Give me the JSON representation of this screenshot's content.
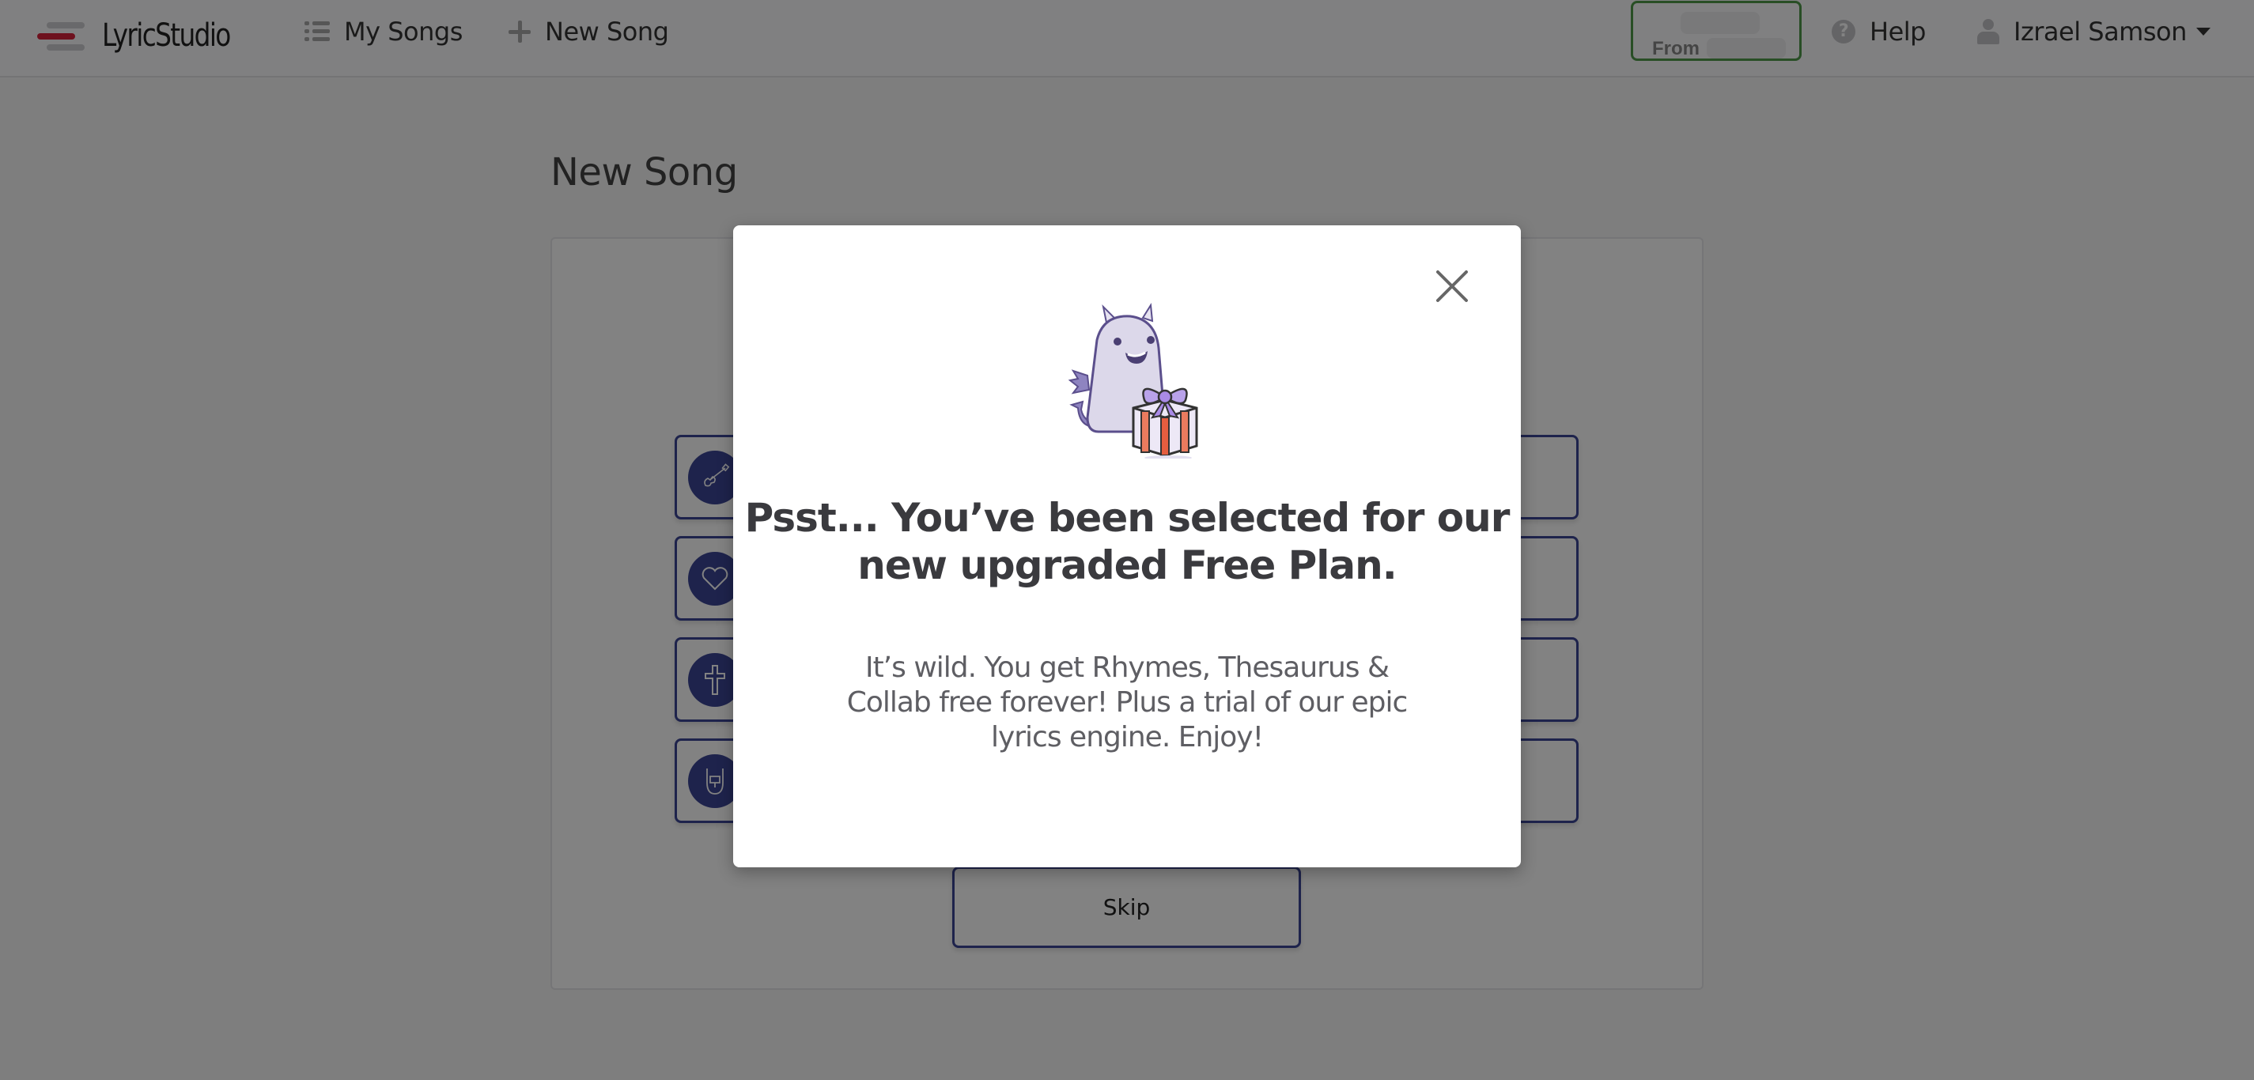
{
  "header": {
    "app_name": "LyricStudio",
    "nav": [
      {
        "label": "My Songs",
        "icon": "list-icon"
      },
      {
        "label": "New Song",
        "icon": "plus-icon"
      }
    ],
    "promo": {
      "from_label": "From"
    },
    "help_label": "Help",
    "user_name": "Izrael Samson"
  },
  "page": {
    "title": "New Song",
    "genre_cards": [
      {
        "icon": "guitar-icon"
      },
      {
        "icon": "heart-icon"
      },
      {
        "icon": "cross-icon"
      },
      {
        "icon": "rock-hand-icon"
      }
    ],
    "skip_label": "Skip"
  },
  "modal": {
    "title_lines": [
      "Psst... You’ve been selected for our",
      "new upgraded Free Plan."
    ],
    "body_lines": [
      "It’s wild. You get Rhymes, Thesaurus &",
      "Collab free forever! Plus a trial of our epic",
      "lyrics engine. Enjoy!"
    ],
    "close_icon": "close-icon"
  },
  "colors": {
    "accent": "#3b4595",
    "logo_red": "#d7223c",
    "promo_green": "#4f9a4a"
  }
}
